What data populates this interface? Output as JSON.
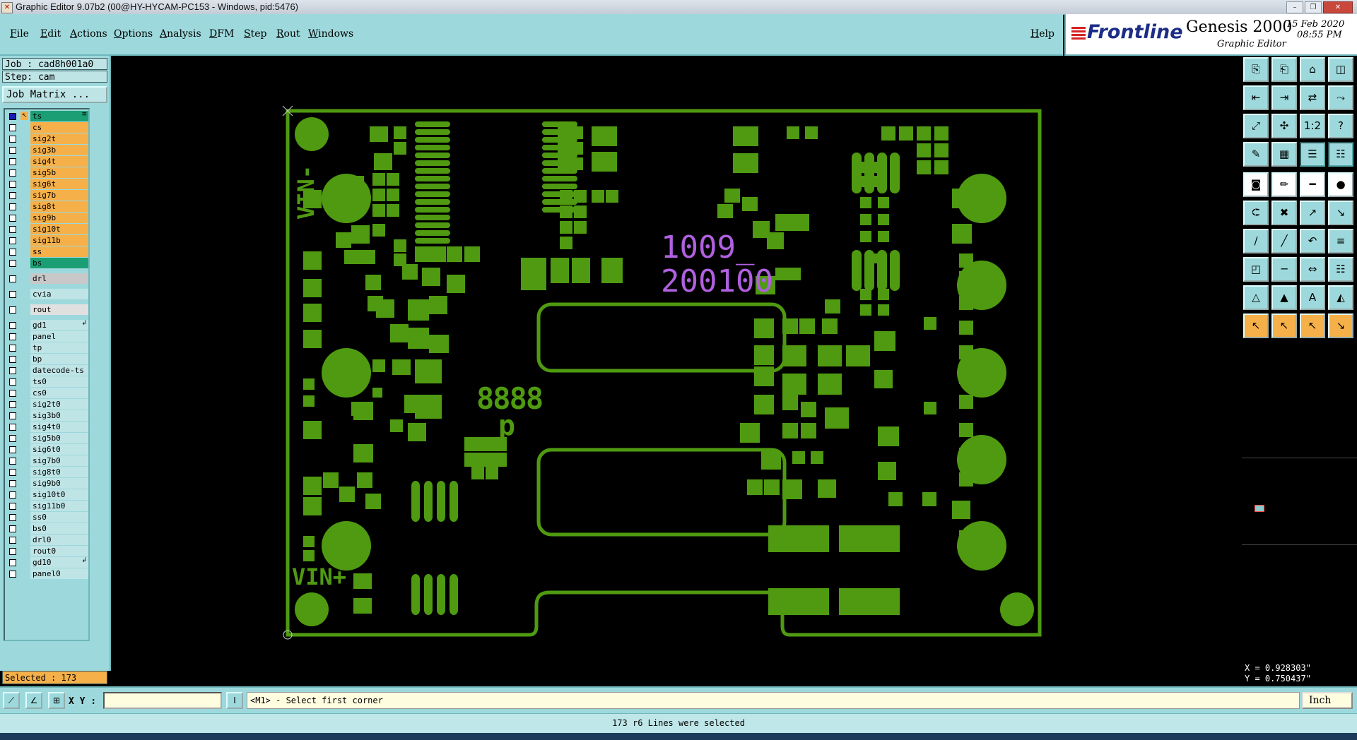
{
  "window": {
    "title": "Graphic Editor 9.07b2 (00@HY-HYCAM-PC153 - Windows, pid:5476)"
  },
  "menu": [
    "File",
    "Edit",
    "Actions",
    "Options",
    "Analysis",
    "DFM",
    "Step",
    "Rout",
    "Windows"
  ],
  "help": "Help",
  "brand": {
    "logo": "Frontline",
    "product": "Genesis 2000",
    "subtitle": "Graphic Editor",
    "date": "15 Feb 2020",
    "time": "08:55 PM"
  },
  "job": {
    "job_line": "Job : cad8h001a0",
    "step_line": "Step: cam",
    "matrix_button": "Job Matrix ..."
  },
  "layers": [
    {
      "name": "ts",
      "color": "#1c9e74",
      "checked": true,
      "mark": "≡"
    },
    {
      "name": "cs",
      "color": "#f5b04a"
    },
    {
      "name": "sig2t",
      "color": "#f5b04a"
    },
    {
      "name": "sig3b",
      "color": "#f5b04a"
    },
    {
      "name": "sig4t",
      "color": "#f5b04a"
    },
    {
      "name": "sig5b",
      "color": "#f5b04a"
    },
    {
      "name": "sig6t",
      "color": "#f5b04a"
    },
    {
      "name": "sig7b",
      "color": "#f5b04a"
    },
    {
      "name": "sig8t",
      "color": "#f5b04a"
    },
    {
      "name": "sig9b",
      "color": "#f5b04a"
    },
    {
      "name": "sig10t",
      "color": "#f5b04a"
    },
    {
      "name": "sig11b",
      "color": "#f5b04a"
    },
    {
      "name": "ss",
      "color": "#f5b04a"
    },
    {
      "name": "bs",
      "color": "#1c9e74"
    },
    {
      "name": "drl",
      "color": "#c8c8c8",
      "gap": true
    },
    {
      "name": "cvia",
      "color": "#bfe4e6",
      "gap": true
    },
    {
      "name": "rout",
      "color": "#e0e0e0",
      "gap": true
    },
    {
      "name": "gd1",
      "color": "#bfe4e6",
      "gap": true,
      "mark": "↲"
    },
    {
      "name": "panel",
      "color": "#bfe4e6"
    },
    {
      "name": "tp",
      "color": "#bfe4e6"
    },
    {
      "name": "bp",
      "color": "#bfe4e6"
    },
    {
      "name": "datecode-ts",
      "color": "#bfe4e6"
    },
    {
      "name": "ts0",
      "color": "#bfe4e6"
    },
    {
      "name": "cs0",
      "color": "#bfe4e6"
    },
    {
      "name": "sig2t0",
      "color": "#bfe4e6"
    },
    {
      "name": "sig3b0",
      "color": "#bfe4e6"
    },
    {
      "name": "sig4t0",
      "color": "#bfe4e6"
    },
    {
      "name": "sig5b0",
      "color": "#bfe4e6"
    },
    {
      "name": "sig6t0",
      "color": "#bfe4e6"
    },
    {
      "name": "sig7b0",
      "color": "#bfe4e6"
    },
    {
      "name": "sig8t0",
      "color": "#bfe4e6"
    },
    {
      "name": "sig9b0",
      "color": "#bfe4e6"
    },
    {
      "name": "sig10t0",
      "color": "#bfe4e6"
    },
    {
      "name": "sig11b0",
      "color": "#bfe4e6"
    },
    {
      "name": "ss0",
      "color": "#bfe4e6"
    },
    {
      "name": "bs0",
      "color": "#bfe4e6"
    },
    {
      "name": "drl0",
      "color": "#bfe4e6"
    },
    {
      "name": "rout0",
      "color": "#bfe4e6"
    },
    {
      "name": "gd10",
      "color": "#bfe4e6",
      "mark": "↲"
    },
    {
      "name": "panel0",
      "color": "#bfe4e6"
    }
  ],
  "selected_count": "Selected : 173",
  "board": {
    "label_vin_minus": "VIN-",
    "label_vin_plus": "VIN+",
    "text_line1": "1009_",
    "text_line2": "200100",
    "text_8888": "8888",
    "text_p": "p",
    "copper_color": "#4f9a11",
    "text_color": "#b060e0"
  },
  "coords": {
    "x": "X = 0.928303\"",
    "y": "Y = 0.750437\""
  },
  "bottom": {
    "xy_label": "X Y :",
    "xy_value": "",
    "prompt": "<M1> - Select first corner",
    "unit": "Inch"
  },
  "status": "173 r6 Lines were selected"
}
